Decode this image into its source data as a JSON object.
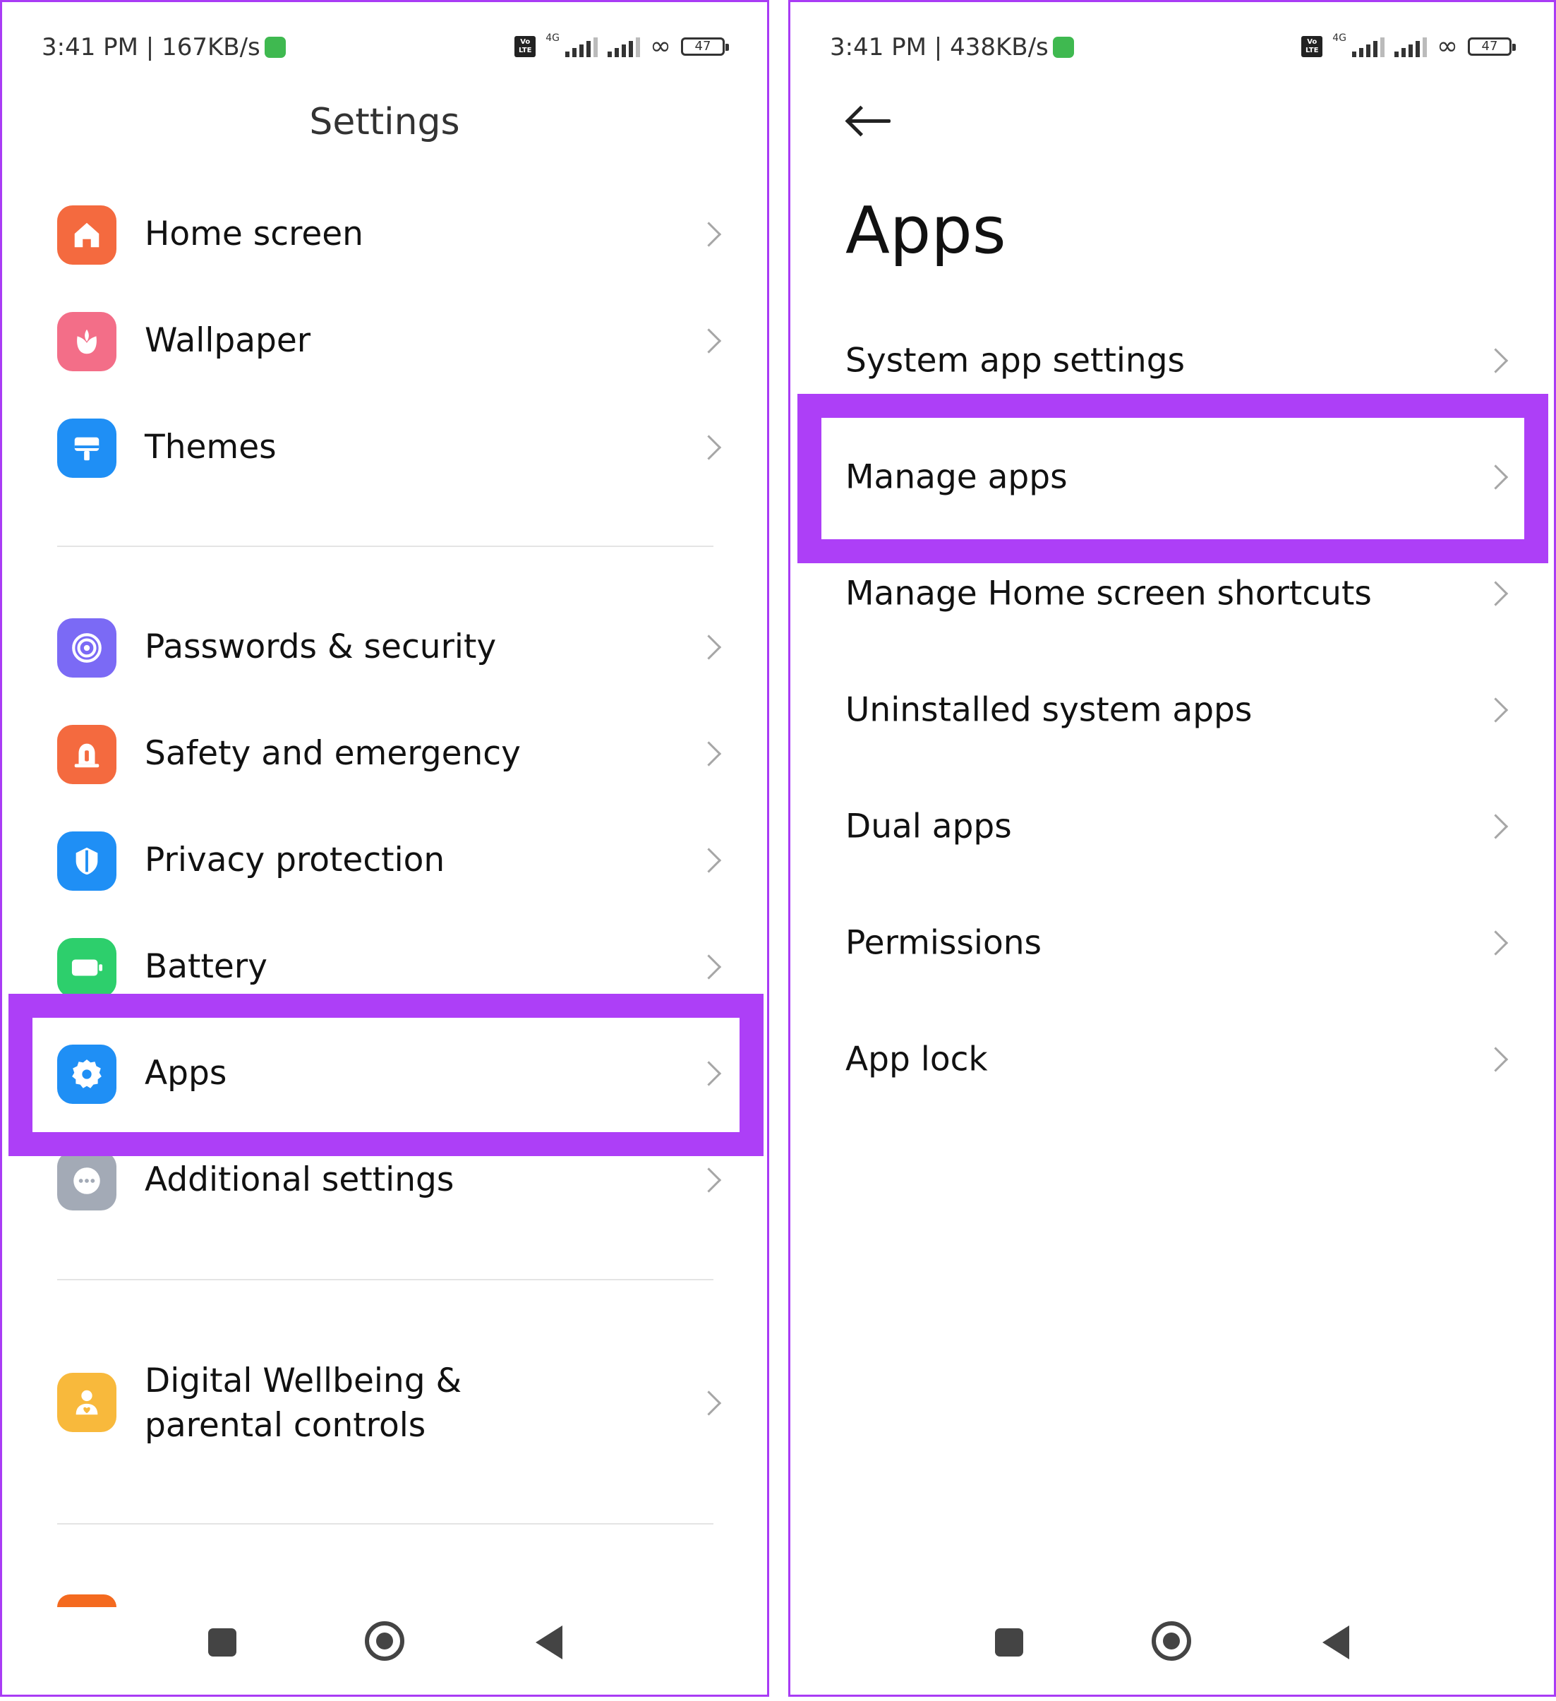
{
  "left": {
    "status": {
      "time": "3:41 PM | 167KB/s",
      "battery": "47",
      "network": "4G"
    },
    "title": "Settings",
    "groups": [
      [
        {
          "label": "Home screen",
          "icon": "home-icon",
          "color": "#f46a3f"
        },
        {
          "label": "Wallpaper",
          "icon": "flower-icon",
          "color": "#f36e88"
        },
        {
          "label": "Themes",
          "icon": "paint-roller-icon",
          "color": "#1f8ff5"
        }
      ],
      [
        {
          "label": "Passwords & security",
          "icon": "fingerprint-icon",
          "color": "#7b6af5"
        },
        {
          "label": "Safety and emergency",
          "icon": "alarm-bell-icon",
          "color": "#f46a3f"
        },
        {
          "label": "Privacy protection",
          "icon": "privacy-shield-icon",
          "color": "#1f8ff5"
        },
        {
          "label": "Battery",
          "icon": "battery-icon",
          "color": "#2dcf6c"
        },
        {
          "label": "Apps",
          "icon": "gear-icon",
          "color": "#1f8ff5"
        },
        {
          "label": "Additional settings",
          "icon": "more-dots-icon",
          "color": "#a3aab6"
        }
      ],
      [
        {
          "label": "Digital Wellbeing & parental controls",
          "icon": "wellbeing-icon",
          "color": "#f8b93c"
        }
      ]
    ],
    "highlighted": "Apps"
  },
  "right": {
    "status": {
      "time": "3:41 PM | 438KB/s",
      "battery": "47",
      "network": "4G"
    },
    "title": "Apps",
    "items": [
      {
        "label": "System app settings"
      },
      {
        "label": "Manage apps"
      },
      {
        "label": "Manage Home screen shortcuts"
      },
      {
        "label": "Uninstalled system apps"
      },
      {
        "label": "Dual apps"
      },
      {
        "label": "Permissions"
      },
      {
        "label": "App lock"
      }
    ],
    "highlighted": "Manage apps"
  },
  "colors": {
    "highlight": "#ad3ff7",
    "chevron": "#a6a6a6"
  }
}
